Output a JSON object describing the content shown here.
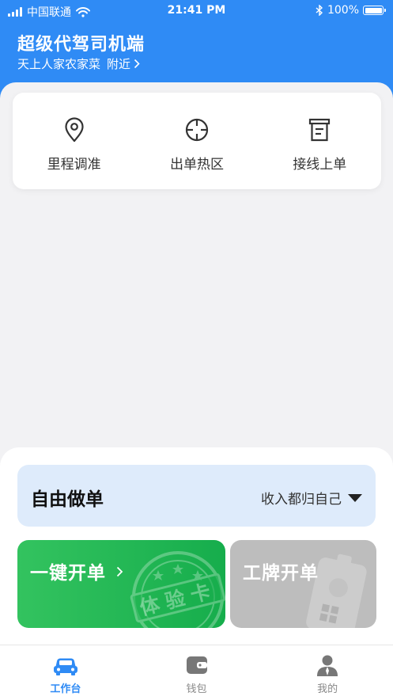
{
  "status_bar": {
    "carrier": "中国联通",
    "time": "21:41 PM",
    "battery": "100%"
  },
  "header": {
    "title": "超级代驾司机端",
    "location": "天上人家农家菜",
    "nearby": "附近"
  },
  "quick_actions": [
    {
      "label": "里程调准",
      "icon": "location-pin-icon"
    },
    {
      "label": "出单热区",
      "icon": "crosshair-icon"
    },
    {
      "label": "接线上单",
      "icon": "clipboard-icon"
    }
  ],
  "free_order": {
    "title": "自由做单",
    "option": "收入都归自己"
  },
  "cards": {
    "one_click": "一键开单",
    "trial_stamp": "体验卡",
    "badge_order": "工牌开单"
  },
  "tabs": [
    {
      "label": "工作台",
      "active": true
    },
    {
      "label": "钱包",
      "active": false
    },
    {
      "label": "我的",
      "active": false
    }
  ],
  "colors": {
    "primary": "#2f8bf5",
    "green": "#22b554",
    "gray_card": "#bdbdbd",
    "free_order_bg": "#deebfb"
  }
}
